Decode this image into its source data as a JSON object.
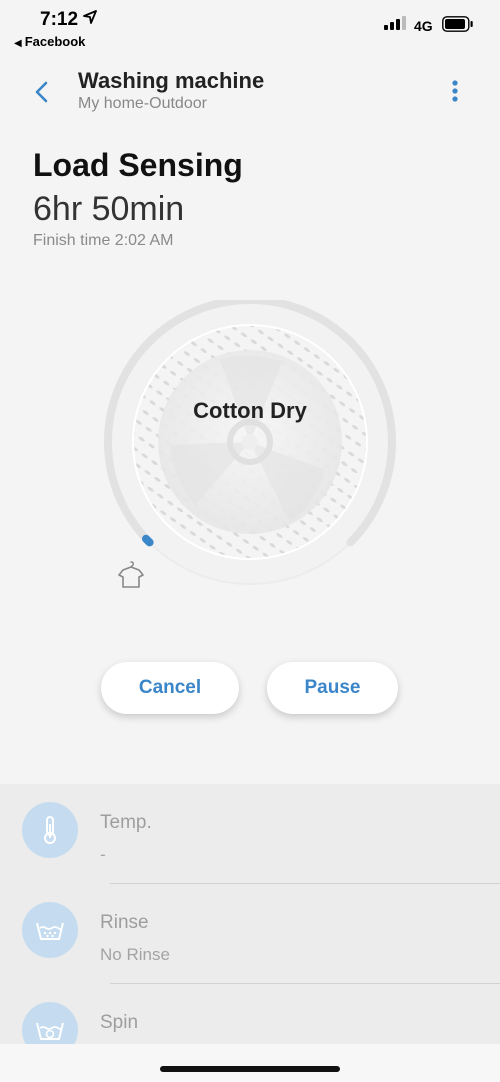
{
  "status_bar": {
    "time": "7:12",
    "back_app": "Facebook",
    "network": "4G"
  },
  "header": {
    "title": "Washing machine",
    "subtitle": "My home-Outdoor"
  },
  "cycle": {
    "status": "Load Sensing",
    "remaining": "6hr 50min",
    "finish": "Finish time 2:02 AM",
    "name": "Cotton Dry",
    "progress_fraction": 0.02
  },
  "buttons": {
    "cancel": "Cancel",
    "pause": "Pause"
  },
  "options": [
    {
      "label": "Temp.",
      "value": "-",
      "icon": "thermometer-icon"
    },
    {
      "label": "Rinse",
      "value": "No Rinse",
      "icon": "rinse-basin-icon"
    },
    {
      "label": "Spin",
      "value": "",
      "icon": "spin-basin-icon"
    }
  ],
  "colors": {
    "accent": "#3a86c8",
    "icon_bg": "#c5dcf0"
  }
}
